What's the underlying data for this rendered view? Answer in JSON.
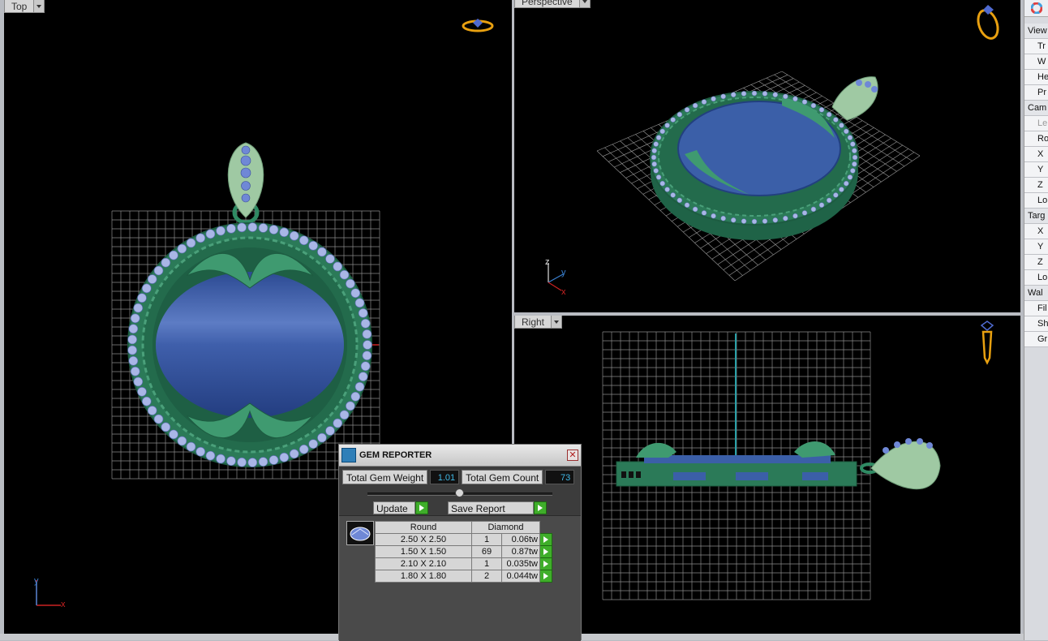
{
  "viewports": {
    "top": {
      "label": "Top"
    },
    "perspective": {
      "label": "Perspective"
    },
    "right": {
      "label": "Right"
    }
  },
  "axes": {
    "x": "x",
    "y": "y",
    "z": "z"
  },
  "side_panel": {
    "rows": [
      {
        "label": "View",
        "kind": "sec"
      },
      {
        "label": "Tr",
        "kind": "it"
      },
      {
        "label": "W",
        "kind": "it"
      },
      {
        "label": "He",
        "kind": "it"
      },
      {
        "label": "Pr",
        "kind": "it"
      },
      {
        "label": "Cam",
        "kind": "sec"
      },
      {
        "label": "Le",
        "kind": "it dim"
      },
      {
        "label": "Ro",
        "kind": "it"
      },
      {
        "label": "X",
        "kind": "it"
      },
      {
        "label": "Y",
        "kind": "it"
      },
      {
        "label": "Z",
        "kind": "it"
      },
      {
        "label": "Lo",
        "kind": "it"
      },
      {
        "label": "Targ",
        "kind": "sec"
      },
      {
        "label": "X",
        "kind": "it"
      },
      {
        "label": "Y",
        "kind": "it"
      },
      {
        "label": "Z",
        "kind": "it"
      },
      {
        "label": "Lo",
        "kind": "it"
      },
      {
        "label": "Wal",
        "kind": "sec"
      },
      {
        "label": "Fil",
        "kind": "it"
      },
      {
        "label": "Sh",
        "kind": "it"
      },
      {
        "label": "Gr",
        "kind": "it"
      }
    ]
  },
  "gem_reporter": {
    "title": "GEM REPORTER",
    "total_weight_label": "Total Gem Weight",
    "total_weight_value": "1.01",
    "total_count_label": "Total Gem Count",
    "total_count_value": "73",
    "update_label": "Update",
    "save_label": "Save Report",
    "header_shape": "Round",
    "header_type": "Diamond",
    "rows": [
      {
        "size": "2.50 X 2.50",
        "count": "1",
        "weight": "0.06tw"
      },
      {
        "size": "1.50 X 1.50",
        "count": "69",
        "weight": "0.87tw"
      },
      {
        "size": "2.10 X 2.10",
        "count": "1",
        "weight": "0.035tw"
      },
      {
        "size": "1.80 X 1.80",
        "count": "2",
        "weight": "0.044tw"
      }
    ]
  },
  "colors": {
    "grid": "#8a8a8a",
    "metal": "#2f8a63",
    "metal_light": "#9fc9a3",
    "gem": "#3b5fa8",
    "diamond": "#a9b6e6",
    "accent_arrow": "#3fae2a"
  }
}
